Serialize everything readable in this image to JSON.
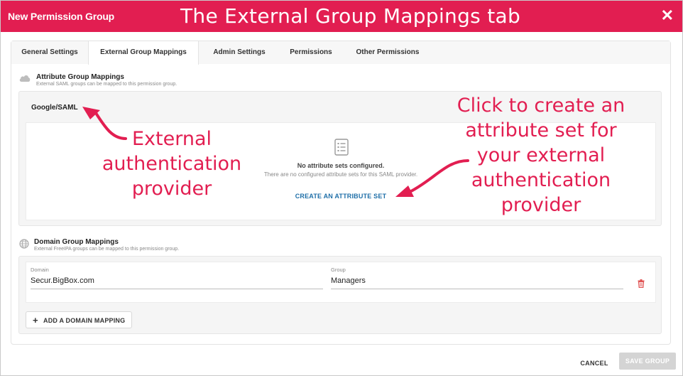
{
  "dialog": {
    "title": "New Permission Group",
    "annotation_title": "The External Group Mappings tab",
    "close_glyph": "✕"
  },
  "tabs": [
    {
      "label": "General Settings",
      "active": false
    },
    {
      "label": "External Group Mappings",
      "active": true
    },
    {
      "label": "Admin Settings",
      "active": false
    },
    {
      "label": "Permissions",
      "active": false
    },
    {
      "label": "Other Permissions",
      "active": false
    }
  ],
  "attribute_section": {
    "icon": "cloud-icon",
    "title": "Attribute Group Mappings",
    "subtitle": "External SAML groups can be mapped to this permission group.",
    "provider": "Google/SAML",
    "empty_icon": "list-icon",
    "empty_title": "No attribute sets configured.",
    "empty_subtitle": "There are no configured attribute sets for this SAML provider.",
    "create_label": "CREATE AN ATTRIBUTE SET"
  },
  "domain_section": {
    "icon": "globe-icon",
    "title": "Domain Group Mappings",
    "subtitle": "External FreeIPA groups can be mapped to this permission group.",
    "domain_label": "Domain",
    "domain_value": "Secur.BigBox.com",
    "group_label": "Group",
    "group_value": "Managers",
    "delete_icon": "trash-icon",
    "add_label": "ADD A DOMAIN MAPPING"
  },
  "annotations": {
    "provider_note": [
      "External",
      "authentication",
      "provider"
    ],
    "create_note": [
      "Click to create an",
      "attribute set for",
      "your external",
      "authentication",
      "provider"
    ]
  },
  "footer": {
    "cancel_label": "CANCEL",
    "save_label": "SAVE GROUP"
  },
  "colors": {
    "brand": "#e21e51",
    "link": "#1f6fa8",
    "delete": "#e05050",
    "disabled": "#d4d4d4"
  }
}
